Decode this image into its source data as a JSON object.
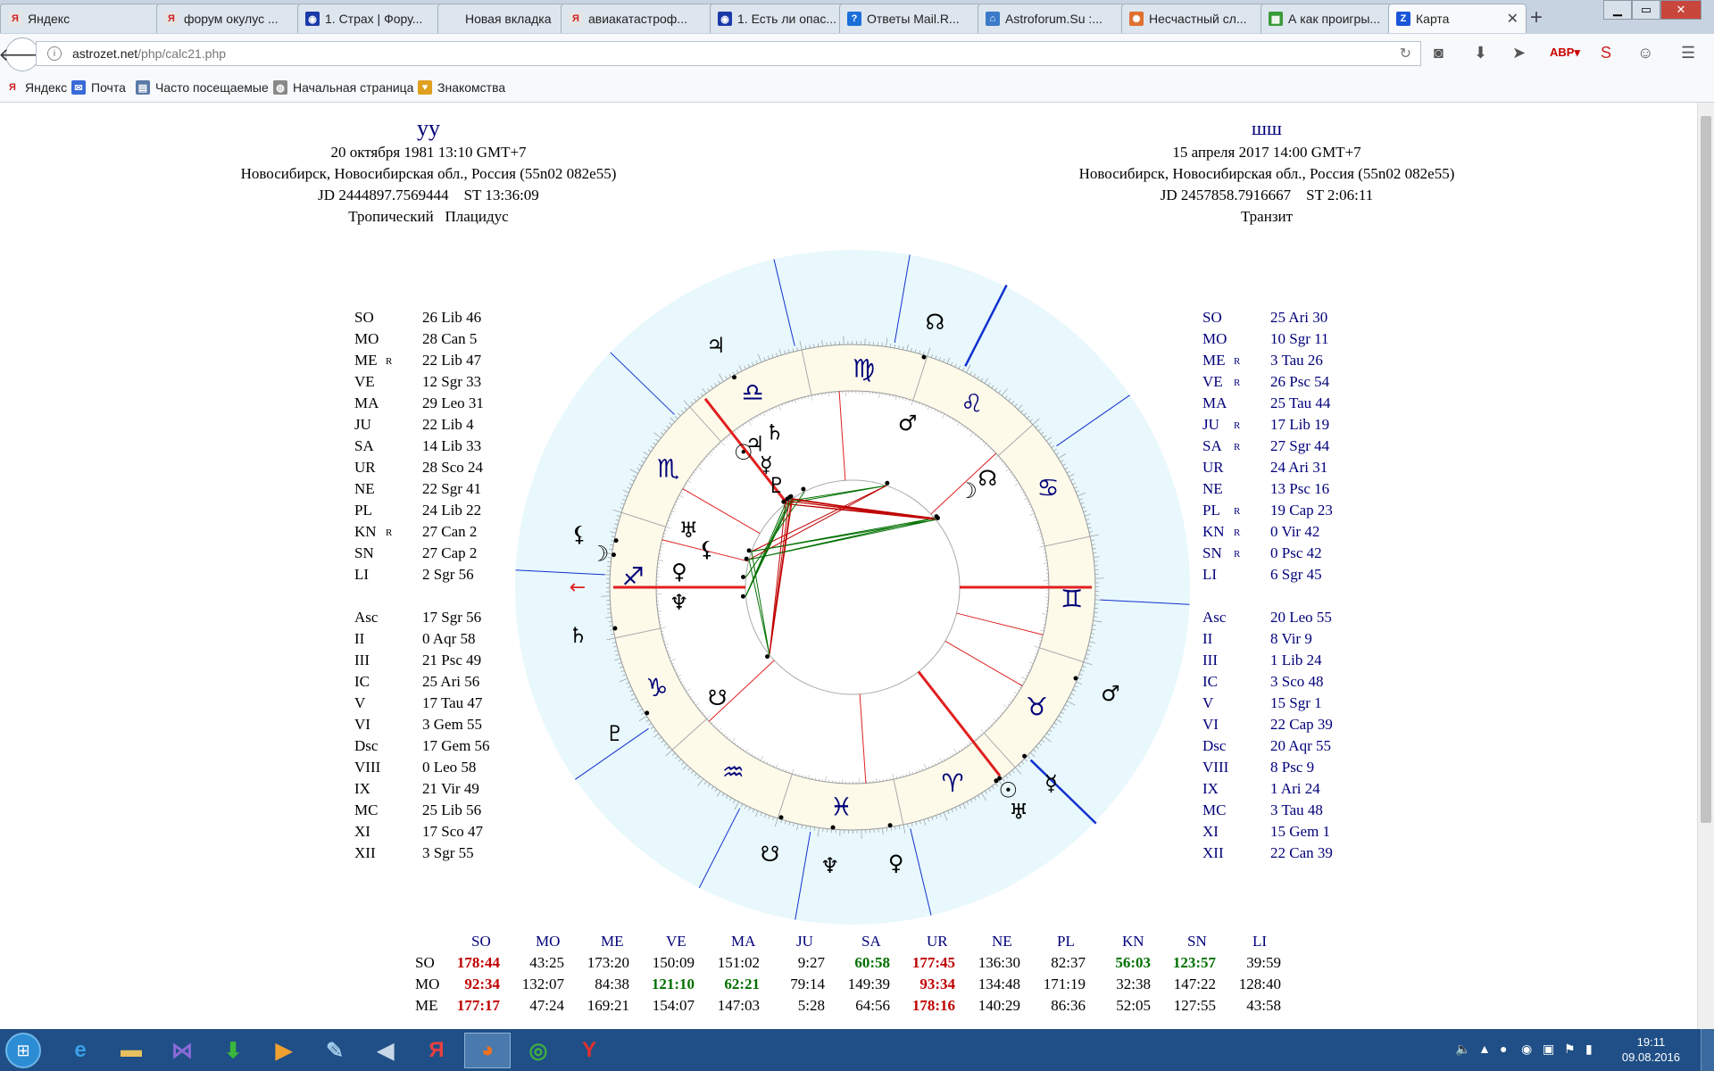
{
  "browser": {
    "tabs": [
      {
        "title": "Яндекс",
        "favicon": "yandex-icon",
        "color": "#e5e5e5",
        "glyph": "Я"
      },
      {
        "title": "форум окулус ...",
        "favicon": "yandex-icon",
        "color": "#e5e5e5",
        "glyph": "Я"
      },
      {
        "title": "1. Страх | Фору...",
        "favicon": "forum-icon",
        "color": "#1a3aa8",
        "glyph": "◉"
      },
      {
        "title": "Новая вкладка",
        "favicon": "blank-icon",
        "color": "#dde5ee",
        "glyph": ""
      },
      {
        "title": "авиакатастроф...",
        "favicon": "yandex-icon",
        "color": "#e5e5e5",
        "glyph": "Я"
      },
      {
        "title": "1. Есть ли опас...",
        "favicon": "forum-icon",
        "color": "#1a3aa8",
        "glyph": "◉"
      },
      {
        "title": "Ответы Mail.R...",
        "favicon": "mail-answers-icon",
        "color": "#1a6fd8",
        "glyph": "?"
      },
      {
        "title": "Astroforum.Su :...",
        "favicon": "astroforum-icon",
        "color": "#3a7ac8",
        "glyph": "⌂"
      },
      {
        "title": "Несчастный сл...",
        "favicon": "zodiac-icon",
        "color": "#e07030",
        "glyph": "✺"
      },
      {
        "title": "А как проигры...",
        "favicon": "windows-icon",
        "color": "#3a9a3a",
        "glyph": "▦"
      },
      {
        "title": "Карта",
        "favicon": "z-icon",
        "color": "#1a56d8",
        "glyph": "Z"
      }
    ],
    "active_tab": 10,
    "url_host": "astrozet.net",
    "url_path": "/php/calc21.php",
    "bookmarks": [
      {
        "label": "Яндекс",
        "favicon": "yandex-icon",
        "glyph": "Я",
        "color": "#fff"
      },
      {
        "label": "Почта",
        "favicon": "mail-icon",
        "glyph": "✉",
        "color": "#3a6ad8"
      },
      {
        "label": "Часто посещаемые",
        "favicon": "folder-icon",
        "glyph": "▤",
        "color": "#5a7aa8"
      },
      {
        "label": "Начальная страница",
        "favicon": "globe-icon",
        "glyph": "◍",
        "color": "#888"
      },
      {
        "label": "Знакомства",
        "favicon": "heart-icon",
        "glyph": "♥",
        "color": "#e0a020"
      }
    ]
  },
  "natal": {
    "name": "уу",
    "date": "20 октября 1981 13:10 GMT+7",
    "place": "Новосибирск, Новосибирская обл., Россия (55n02 082e55)",
    "jd": "JD 2444897.7569444",
    "st": "ST 13:36:09",
    "system": "Тропический",
    "houses": "Плацидус"
  },
  "transit": {
    "name": "шш",
    "date": "15 апреля 2017 14:00 GMT+7",
    "place": "Новосибирск, Новосибирская обл., Россия (55n02 082e55)",
    "jd": "JD 2457858.7916667",
    "st": "ST 2:06:11",
    "system": "Транзит"
  },
  "natal_positions": [
    {
      "p": "SO",
      "v": "26 Lib 46",
      "r": ""
    },
    {
      "p": "MO",
      "v": "28 Can 5",
      "r": ""
    },
    {
      "p": "ME",
      "v": "22 Lib 47",
      "r": "R"
    },
    {
      "p": "VE",
      "v": "12 Sgr 33",
      "r": ""
    },
    {
      "p": "MA",
      "v": "29 Leo 31",
      "r": ""
    },
    {
      "p": "JU",
      "v": "22 Lib 4",
      "r": ""
    },
    {
      "p": "SA",
      "v": "14 Lib 33",
      "r": ""
    },
    {
      "p": "UR",
      "v": "28 Sco 24",
      "r": ""
    },
    {
      "p": "NE",
      "v": "22 Sgr 41",
      "r": ""
    },
    {
      "p": "PL",
      "v": "24 Lib 22",
      "r": ""
    },
    {
      "p": "KN",
      "v": "27 Can 2",
      "r": "R"
    },
    {
      "p": "SN",
      "v": "27 Cap 2",
      "r": ""
    },
    {
      "p": "LI",
      "v": "2 Sgr 56",
      "r": ""
    }
  ],
  "natal_houses": [
    {
      "p": "Asc",
      "v": "17 Sgr 56"
    },
    {
      "p": "II",
      "v": "0 Aqr 58"
    },
    {
      "p": "III",
      "v": "21 Psc 49"
    },
    {
      "p": "IC",
      "v": "25 Ari 56"
    },
    {
      "p": "V",
      "v": "17 Tau 47"
    },
    {
      "p": "VI",
      "v": "3 Gem 55"
    },
    {
      "p": "Dsc",
      "v": "17 Gem 56"
    },
    {
      "p": "VIII",
      "v": "0 Leo 58"
    },
    {
      "p": "IX",
      "v": "21 Vir 49"
    },
    {
      "p": "MC",
      "v": "25 Lib 56"
    },
    {
      "p": "XI",
      "v": "17 Sco 47"
    },
    {
      "p": "XII",
      "v": "3 Sgr 55"
    }
  ],
  "transit_positions": [
    {
      "p": "SO",
      "v": "25 Ari 30",
      "r": ""
    },
    {
      "p": "MO",
      "v": "10 Sgr 11",
      "r": ""
    },
    {
      "p": "ME",
      "v": "3 Tau 26",
      "r": "R"
    },
    {
      "p": "VE",
      "v": "26 Psc 54",
      "r": "R"
    },
    {
      "p": "MA",
      "v": "25 Tau 44",
      "r": ""
    },
    {
      "p": "JU",
      "v": "17 Lib 19",
      "r": "R"
    },
    {
      "p": "SA",
      "v": "27 Sgr 44",
      "r": "R"
    },
    {
      "p": "UR",
      "v": "24 Ari 31",
      "r": ""
    },
    {
      "p": "NE",
      "v": "13 Psc 16",
      "r": ""
    },
    {
      "p": "PL",
      "v": "19 Cap 23",
      "r": "R"
    },
    {
      "p": "KN",
      "v": "0 Vir 42",
      "r": "R"
    },
    {
      "p": "SN",
      "v": "0 Psc 42",
      "r": "R"
    },
    {
      "p": "LI",
      "v": "6 Sgr 45",
      "r": ""
    }
  ],
  "transit_houses": [
    {
      "p": "Asc",
      "v": "20 Leo 55"
    },
    {
      "p": "II",
      "v": "8 Vir 9"
    },
    {
      "p": "III",
      "v": "1 Lib 24"
    },
    {
      "p": "IC",
      "v": "3 Sco 48"
    },
    {
      "p": "V",
      "v": "15 Sgr 1"
    },
    {
      "p": "VI",
      "v": "22 Cap 39"
    },
    {
      "p": "Dsc",
      "v": "20 Aqr 55"
    },
    {
      "p": "VIII",
      "v": "8 Psc 9"
    },
    {
      "p": "IX",
      "v": "1 Ari 24"
    },
    {
      "p": "MC",
      "v": "3 Tau 48"
    },
    {
      "p": "XI",
      "v": "15 Gem 1"
    },
    {
      "p": "XII",
      "v": "22 Can 39"
    }
  ],
  "aspect_table": {
    "columns": [
      "SO",
      "MO",
      "ME",
      "VE",
      "MA",
      "JU",
      "SA",
      "UR",
      "NE",
      "PL",
      "KN",
      "SN",
      "LI"
    ],
    "rows": [
      {
        "label": "SO",
        "cells": [
          [
            "178:44",
            "red"
          ],
          [
            "43:25",
            ""
          ],
          [
            "173:20",
            ""
          ],
          [
            "150:09",
            ""
          ],
          [
            "151:02",
            ""
          ],
          [
            "9:27",
            ""
          ],
          [
            "60:58",
            "green"
          ],
          [
            "177:45",
            "red"
          ],
          [
            "136:30",
            ""
          ],
          [
            "82:37",
            ""
          ],
          [
            "56:03",
            "green"
          ],
          [
            "123:57",
            "green"
          ],
          [
            "39:59",
            ""
          ]
        ]
      },
      {
        "label": "MO",
        "cells": [
          [
            "92:34",
            "red"
          ],
          [
            "132:07",
            ""
          ],
          [
            "84:38",
            ""
          ],
          [
            "121:10",
            "green"
          ],
          [
            "62:21",
            "green"
          ],
          [
            "79:14",
            ""
          ],
          [
            "149:39",
            ""
          ],
          [
            "93:34",
            "red"
          ],
          [
            "134:48",
            ""
          ],
          [
            "171:19",
            ""
          ],
          [
            "32:38",
            ""
          ],
          [
            "147:22",
            ""
          ],
          [
            "128:40",
            ""
          ]
        ]
      },
      {
        "label": "ME",
        "cells": [
          [
            "177:17",
            "red"
          ],
          [
            "47:24",
            ""
          ],
          [
            "169:21",
            ""
          ],
          [
            "154:07",
            ""
          ],
          [
            "147:03",
            ""
          ],
          [
            "5:28",
            ""
          ],
          [
            "64:56",
            ""
          ],
          [
            "178:16",
            "red"
          ],
          [
            "140:29",
            ""
          ],
          [
            "86:36",
            ""
          ],
          [
            "52:05",
            ""
          ],
          [
            "127:55",
            ""
          ],
          [
            "43:58",
            ""
          ]
        ]
      }
    ]
  },
  "taskbar": {
    "clock_time": "19:11",
    "clock_date": "09.08.2016",
    "apps": [
      {
        "name": "ie-icon",
        "glyph": "e",
        "color": "#3aa0e8"
      },
      {
        "name": "explorer-icon",
        "glyph": "▬",
        "color": "#e8c060"
      },
      {
        "name": "visualstudio-icon",
        "glyph": "⋈",
        "color": "#8a6ad8"
      },
      {
        "name": "download-icon",
        "glyph": "⬇",
        "color": "#3ab83a"
      },
      {
        "name": "media-icon",
        "glyph": "▶",
        "color": "#f0a030"
      },
      {
        "name": "notepad-icon",
        "glyph": "✎",
        "color": "#a0c8e8"
      },
      {
        "name": "volume-app-icon",
        "glyph": "◀",
        "color": "#c8d8e8"
      },
      {
        "name": "yandex-app-icon",
        "glyph": "Я",
        "color": "#e84040"
      },
      {
        "name": "firefox-icon",
        "glyph": "◕",
        "color": "#f07020"
      },
      {
        "name": "chrome-icon",
        "glyph": "◎",
        "color": "#40b040"
      },
      {
        "name": "yandex-browser-icon",
        "glyph": "Y",
        "color": "#e03030"
      }
    ],
    "active_app": 8
  },
  "colors": {
    "natal_text": "#000000",
    "transit_text": "#00007a",
    "aspect_red": "#c00000",
    "aspect_green": "#007000",
    "chart_outer_bg": "#e8f8fc",
    "zodiac_ring_bg": "#fdfaea",
    "axis_red": "#e02020",
    "transit_blue": "#1030d0"
  },
  "wheel": {
    "signs": [
      {
        "name": "aries-icon",
        "glyph": "♈"
      },
      {
        "name": "taurus-icon",
        "glyph": "♉"
      },
      {
        "name": "gemini-icon",
        "glyph": "♊"
      },
      {
        "name": "cancer-icon",
        "glyph": "♋"
      },
      {
        "name": "leo-icon",
        "glyph": "♌"
      },
      {
        "name": "virgo-icon",
        "glyph": "♍"
      },
      {
        "name": "libra-icon",
        "glyph": "♎"
      },
      {
        "name": "scorpio-icon",
        "glyph": "♏"
      },
      {
        "name": "sagittarius-icon",
        "glyph": "♐"
      },
      {
        "name": "capricorn-icon",
        "glyph": "♑"
      },
      {
        "name": "aquarius-icon",
        "glyph": "♒"
      },
      {
        "name": "pisces-icon",
        "glyph": "♓"
      }
    ],
    "asc_lon": 257.93
  }
}
